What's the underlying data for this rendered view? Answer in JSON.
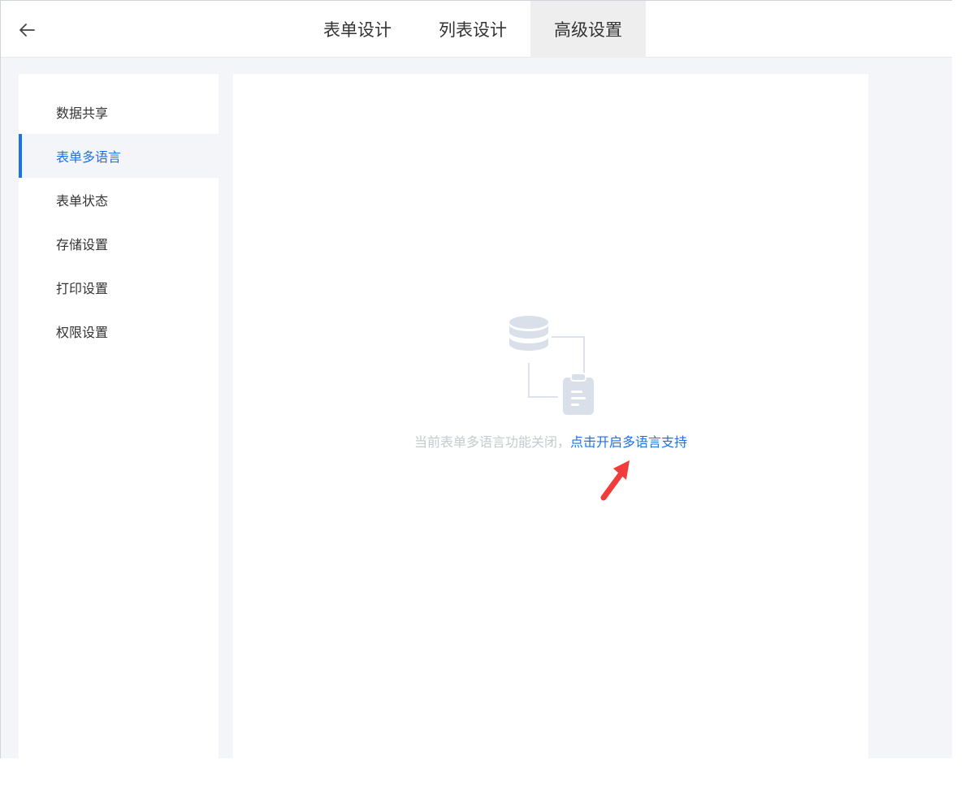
{
  "topbar": {
    "back_icon": "arrow-left-icon",
    "tabs": [
      {
        "label": "表单设计",
        "active": false
      },
      {
        "label": "列表设计",
        "active": false
      },
      {
        "label": "高级设置",
        "active": true
      }
    ]
  },
  "sidebar": {
    "items": [
      {
        "label": "数据共享",
        "active": false
      },
      {
        "label": "表单多语言",
        "active": true
      },
      {
        "label": "表单状态",
        "active": false
      },
      {
        "label": "存储设置",
        "active": false
      },
      {
        "label": "打印设置",
        "active": false
      },
      {
        "label": "权限设置",
        "active": false
      }
    ]
  },
  "main": {
    "empty_state": {
      "illustration_icon": "database-clipboard-icon",
      "message": "当前表单多语言功能关闭，",
      "action_link": "点击开启多语言支持",
      "annotation_icon": "red-arrow-icon"
    }
  },
  "colors": {
    "accent": "#1a73e8",
    "annotation": "#f23b3b",
    "muted_text": "#c5c9d0",
    "background": "#f3f5f9"
  }
}
